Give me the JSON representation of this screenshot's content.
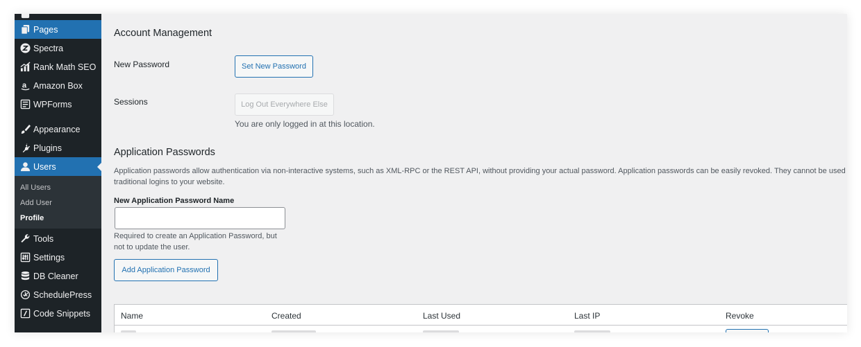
{
  "sidebar": {
    "items": [
      {
        "label": "Pages",
        "icon": "pages-icon"
      },
      {
        "label": "Spectra",
        "icon": "spectra-icon"
      },
      {
        "label": "Rank Math SEO",
        "icon": "rank-math-icon"
      },
      {
        "label": "Amazon Box",
        "icon": "amazon-icon"
      },
      {
        "label": "WPForms",
        "icon": "wpforms-icon"
      },
      {
        "label": "Appearance",
        "icon": "brush-icon"
      },
      {
        "label": "Plugins",
        "icon": "plugin-icon"
      },
      {
        "label": "Users",
        "icon": "users-icon"
      },
      {
        "label": "Tools",
        "icon": "wrench-icon"
      },
      {
        "label": "Settings",
        "icon": "settings-icon"
      },
      {
        "label": "DB Cleaner",
        "icon": "database-icon"
      },
      {
        "label": "SchedulePress",
        "icon": "clock-icon"
      },
      {
        "label": "Code Snippets",
        "icon": "code-icon"
      }
    ],
    "submenu": [
      "All Users",
      "Add User",
      "Profile"
    ]
  },
  "account": {
    "title": "Account Management",
    "new_password_label": "New Password",
    "set_password_button": "Set New Password",
    "sessions_label": "Sessions",
    "logout_button": "Log Out Everywhere Else",
    "sessions_note": "You are only logged in at this location."
  },
  "app_passwords": {
    "title": "Application Passwords",
    "description": "Application passwords allow authentication via non-interactive systems, such as XML-RPC or the REST API, without providing your actual password. Application passwords can be easily revoked. They cannot be used for traditional logins to your website.",
    "name_label": "New Application Password Name",
    "name_value": "",
    "help_text": "Required to create an Application Password, but not to update the user.",
    "add_button": "Add Application Password",
    "table_headers": [
      "Name",
      "Created",
      "Last Used",
      "Last IP",
      "Revoke"
    ]
  },
  "colors": {
    "sidebar_bg": "#1d2327",
    "active_bg": "#2271b1",
    "content_bg": "#f0f0f1",
    "link_blue": "#2271b1"
  }
}
